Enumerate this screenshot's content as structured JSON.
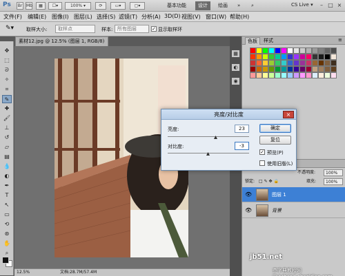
{
  "app": {
    "logo": "Ps",
    "cs_live": "CS Live ▾"
  },
  "workspace": {
    "basic": "基本功能",
    "design": "设计",
    "paint": "绘画"
  },
  "menus": [
    "文件(F)",
    "编辑(E)",
    "图像(I)",
    "图层(L)",
    "选择(S)",
    "滤镜(T)",
    "分析(A)",
    "3D(D)",
    "视图(V)",
    "窗口(W)",
    "帮助(H)"
  ],
  "options": {
    "sample_size_label": "取样大小:",
    "sample_size_value": "取样点",
    "sample_label": "样本:",
    "sample_value": "所有图层",
    "show_ring_label": "显示取样环",
    "show_ring_checked": true
  },
  "document": {
    "tab_title": "素材12.jpg @ 12.5% (图层 1, RGB/8) * ×",
    "zoom": "12.5%",
    "doc_info": "文档:28.7M/57.4M"
  },
  "panels": {
    "swatches_tab": "色板",
    "styles_tab": "样式",
    "layers": {
      "header": "正常",
      "opacity_label": "不透明度:",
      "opacity_value": "100%",
      "fill_label": "填充:",
      "fill_value": "100%",
      "lock_label": "锁定:",
      "items": [
        {
          "name": "图层 1",
          "selected": true
        },
        {
          "name": "背景",
          "selected": false
        }
      ]
    }
  },
  "dialog": {
    "title": "亮度/对比度",
    "brightness_label": "亮度:",
    "brightness_value": "23",
    "contrast_label": "对比度:",
    "contrast_value": "-3",
    "ok": "确定",
    "reset": "复位",
    "preview_label": "预览(P)",
    "preview_checked": true,
    "legacy_label": "使用旧版(L)",
    "legacy_checked": false
  },
  "watermark": {
    "line1": "jb51.net",
    "line2": "查字典教程网 jiaocheng.chazidian.com"
  },
  "swatch_colors": [
    "#ff0000",
    "#ffff00",
    "#00ff00",
    "#00ffff",
    "#0000ff",
    "#ff00ff",
    "#ffffff",
    "#e6e6e6",
    "#cccccc",
    "#b3b3b3",
    "#999999",
    "#808080",
    "#666666",
    "#4d4d4d",
    "#ff3300",
    "#ff9900",
    "#ccff00",
    "#33cc33",
    "#00cc99",
    "#0099ff",
    "#3333cc",
    "#9933ff",
    "#cc0099",
    "#ff0066",
    "#333333",
    "#1a1a1a",
    "#000000",
    "#f2e6d9",
    "#cc3333",
    "#ff6633",
    "#ffcc33",
    "#99cc33",
    "#33cc66",
    "#33cccc",
    "#3366cc",
    "#6633cc",
    "#993399",
    "#cc3366",
    "#996633",
    "#663300",
    "#7f5f3f",
    "#3f2f1f",
    "#990000",
    "#cc6600",
    "#cc9900",
    "#669900",
    "#009933",
    "#009999",
    "#003399",
    "#330099",
    "#660066",
    "#990033",
    "#c0a080",
    "#a08060",
    "#806040",
    "#604020",
    "#ff9999",
    "#ffcc99",
    "#ffff99",
    "#ccff99",
    "#99ffcc",
    "#99ffff",
    "#99ccff",
    "#cc99ff",
    "#ff99ff",
    "#ff99cc",
    "#ddeeff",
    "#ffeedd",
    "#eeffdd",
    "#ffddee"
  ]
}
